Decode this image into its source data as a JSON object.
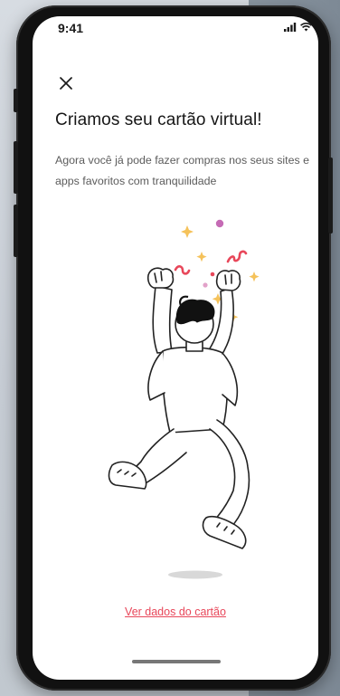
{
  "status_bar": {
    "time": "9:41"
  },
  "modal": {
    "title": "Criamos seu cartão virtual!",
    "subtitle": "Agora você já pode fazer compras nos seus sites e apps favoritos com tranquilidade",
    "primary_link": "Ver dados do cartão",
    "accent_color": "#e8475a",
    "illustration": "celebrating-person-icon"
  }
}
